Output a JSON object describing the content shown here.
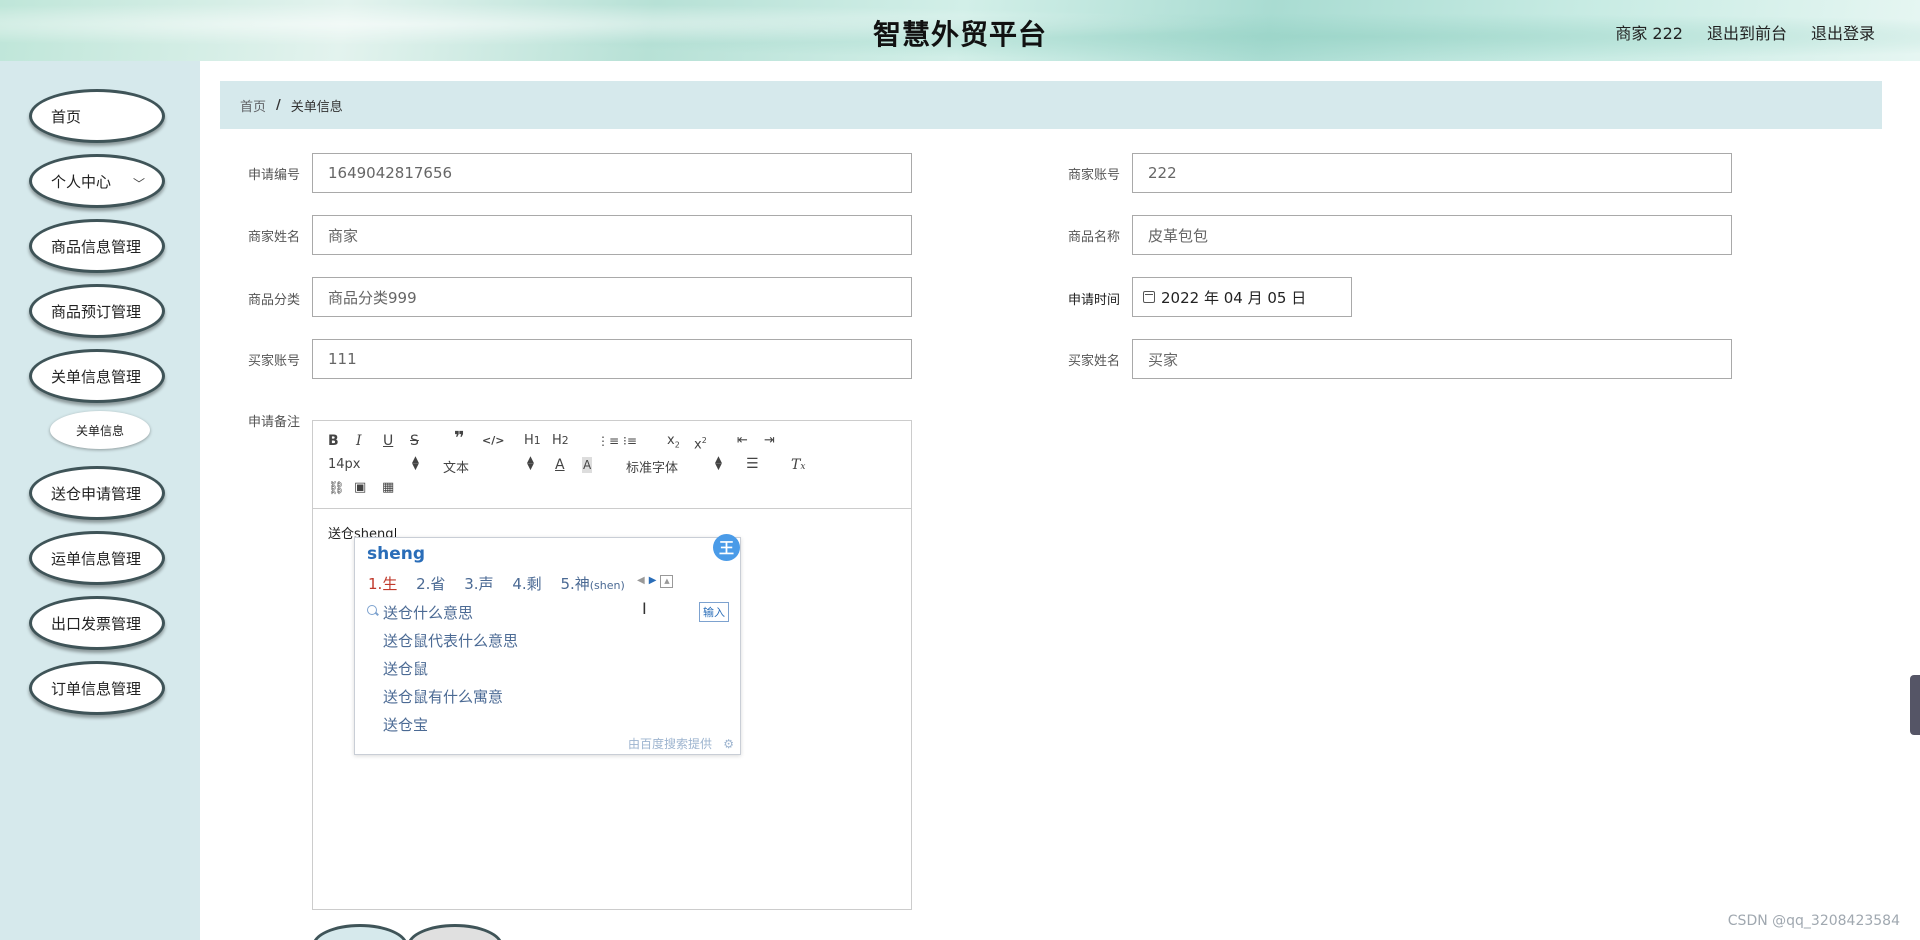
{
  "header": {
    "title": "智慧外贸平台",
    "user": "商家 222",
    "to_front": "退出到前台",
    "logout": "退出登录"
  },
  "sidebar": {
    "items": [
      {
        "label": "首页"
      },
      {
        "label": "个人中心"
      },
      {
        "label": "商品信息管理"
      },
      {
        "label": "商品预订管理"
      },
      {
        "label": "关单信息管理"
      },
      {
        "label": "送仓申请管理"
      },
      {
        "label": "运单信息管理"
      },
      {
        "label": "出口发票管理"
      },
      {
        "label": "订单信息管理"
      }
    ],
    "sub_item": "关单信息"
  },
  "breadcrumb": {
    "home": "首页",
    "separator": "/",
    "current": "关单信息"
  },
  "form": {
    "apply_no_label": "申请编号",
    "apply_no_value": "1649042817656",
    "merchant_account_label": "商家账号",
    "merchant_account_value": "222",
    "merchant_name_label": "商家姓名",
    "merchant_name_value": "商家",
    "product_name_label": "商品名称",
    "product_name_value": "皮革包包",
    "category_label": "商品分类",
    "category_value": "商品分类999",
    "apply_time_label": "申请时间",
    "apply_time_value": "2022 年 04 月 05 日",
    "buyer_account_label": "买家账号",
    "buyer_account_value": "111",
    "buyer_name_label": "买家姓名",
    "buyer_name_value": "买家",
    "remark_label": "申请备注"
  },
  "editor": {
    "font_size": "14px",
    "block_type": "文本",
    "font_family": "标准字体",
    "content_prefix": "送仓",
    "content_typed": "sheng"
  },
  "ime": {
    "pinyin": "sheng",
    "logo": "王",
    "candidates": [
      {
        "num": "1.",
        "text": "生"
      },
      {
        "num": "2.",
        "text": "省"
      },
      {
        "num": "3.",
        "text": "声"
      },
      {
        "num": "4.",
        "text": "剩"
      },
      {
        "num": "5.",
        "text": "神",
        "hint": "(shen)"
      }
    ],
    "suggestions": [
      "送仓什么意思",
      "送仓鼠代表什么意思",
      "送仓鼠",
      "送仓鼠有什么寓意",
      "送仓宝"
    ],
    "input_button": "输入",
    "footer": "由百度搜索提供"
  },
  "watermark": "CSDN @qq_3208423584"
}
